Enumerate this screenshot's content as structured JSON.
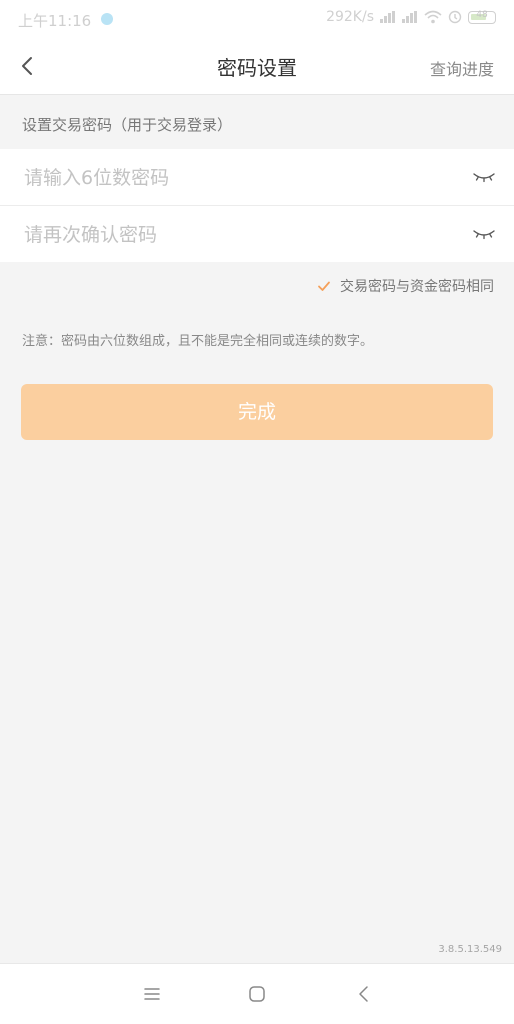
{
  "status_bar": {
    "time": "上午11:16",
    "speed": "292K/s",
    "battery": "48"
  },
  "nav": {
    "title": "密码设置",
    "right_action": "查询进度",
    "back_icon": "chevron-left-icon"
  },
  "form": {
    "section_label": "设置交易密码（用于交易登录）",
    "password_placeholder": "请输入6位数密码",
    "confirm_placeholder": "请再次确认密码",
    "eye_icon": "eye-closed-icon",
    "same_password_label": "交易密码与资金密码相同",
    "same_password_checked": true,
    "notice": "注意：密码由六位数组成，且不能是完全相同或连续的数字。",
    "submit_label": "完成"
  },
  "version": "3.8.5.13.549",
  "colors": {
    "accent": "#f5a05a",
    "button_disabled": "#fbcf9f",
    "background": "#f4f4f4"
  },
  "system_nav": {
    "menu_icon": "menu-icon",
    "home_icon": "home-icon",
    "back_icon": "back-triangle-icon"
  }
}
